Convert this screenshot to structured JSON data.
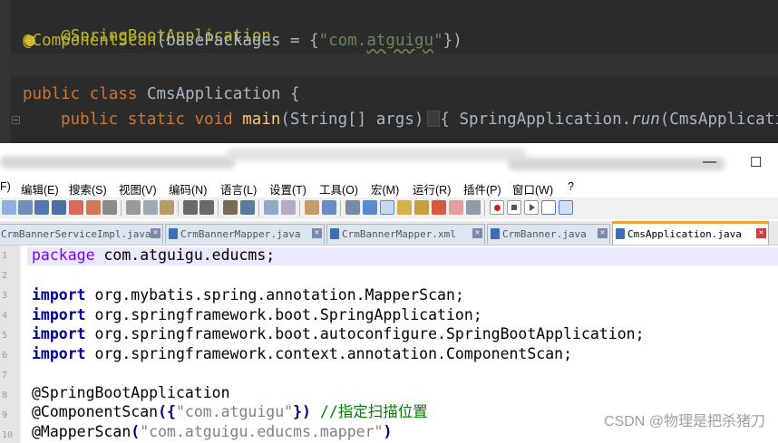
{
  "dark_editor": {
    "lines": [
      {
        "ann": "@SpringBootApplication"
      },
      {
        "ann_prefix": "@",
        "ann_cursor": "C",
        "ann_rest": "omponentScan",
        "args_open": "(basePackages = {",
        "str_open": "\"com.",
        "str_under": "atguigu",
        "str_close": "\"",
        "args_close": "})"
      },
      {},
      {
        "kw1": "public ",
        "kw2": "class ",
        "name": "CmsApplication {"
      },
      {
        "kw1": "public ",
        "kw2": "static ",
        "kw3": "void ",
        "fn": "main",
        "args": "(String[] args)",
        "brace": "{",
        "call": " SpringApplication.",
        "call_it": "run",
        "call_rest": "(CmsApplicatio"
      }
    ]
  },
  "window": {
    "minimize_glyph": "—",
    "maximize_glyph": "☐"
  },
  "menu": {
    "items": [
      "F)",
      "编辑(E)",
      "搜索(S)",
      "视图(V)",
      "编码(N)",
      "语言(L)",
      "设置(T)",
      "工具(O)",
      "宏(M)",
      "运行(R)",
      "插件(P)",
      "窗口(W)",
      "?"
    ]
  },
  "tabs": [
    {
      "label": "CrmBannerServiceImpl.java",
      "active": false
    },
    {
      "label": "CrmBannerMapper.java",
      "active": false
    },
    {
      "label": "CrmBannerMapper.xml",
      "active": false
    },
    {
      "label": "CrmBanner.java",
      "active": false
    },
    {
      "label": "CmsApplication.java",
      "active": true
    }
  ],
  "tab_close_glyph": "✕",
  "editor": {
    "line_numbers": [
      "1",
      "2",
      "3",
      "4",
      "5",
      "6",
      "7",
      "8",
      "9",
      "10"
    ],
    "l1_kw": "package",
    "l1_rest": " com.atguigu.educms;",
    "l3_kw": "import",
    "l3_rest": " org.mybatis.spring.annotation.MapperScan;",
    "l4_kw": "import",
    "l4_rest": " org.springframework.boot.SpringApplication;",
    "l5_kw": "import",
    "l5_rest": " org.springframework.boot.autoconfigure.SpringBootApplication;",
    "l6_kw": "import",
    "l6_rest": " org.springframework.context.annotation.ComponentScan;",
    "l8": "@SpringBootApplication",
    "l9_a": "@ComponentScan",
    "l9_op1": "({",
    "l9_str": "\"com.atguigu\"",
    "l9_op2": "})",
    "l9_cmt": " //指定扫描位置",
    "l10_a": "@MapperScan",
    "l10_op1": "(",
    "l10_str": "\"com.atguigu.educms.mapper\"",
    "l10_op2": ")"
  },
  "watermark": "CSDN @物理是把杀猪刀"
}
